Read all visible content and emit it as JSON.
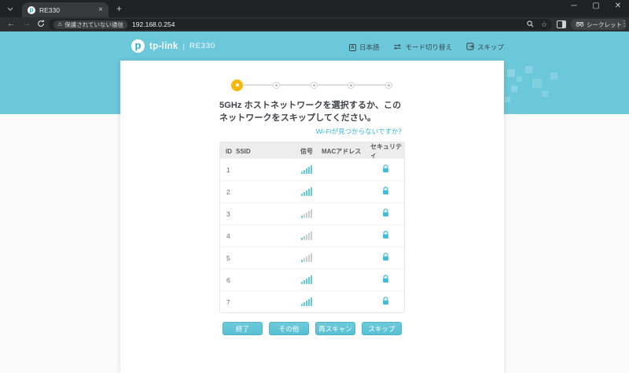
{
  "browser": {
    "tab_title": "RE330",
    "new_tab_label": "+",
    "url": "192.168.0.254",
    "security_chip": "保護されていない通信",
    "incognito_label": "シークレット",
    "window_controls": {
      "minimize": "─",
      "maximize": "▢",
      "close": "✕"
    },
    "back": "←",
    "forward": "→",
    "tab_close": "×",
    "menu": "⋮",
    "bookmark_star": "☆",
    "warning": "⚠"
  },
  "app": {
    "brand": "tp-link",
    "brand_glyph": "p",
    "separator": "|",
    "model": "RE330",
    "nav": [
      {
        "label": "日本語",
        "icon": "language-icon",
        "glyph": "A"
      },
      {
        "label": "モード切り替え",
        "icon": "mode-switch-icon"
      },
      {
        "label": "スキップ",
        "icon": "skip-icon"
      }
    ]
  },
  "wizard": {
    "total_steps": 5,
    "active_step": 1,
    "title": "5GHz ホストネットワークを選択するか、このネットワークをスキップしてください。",
    "help_link": "Wi-Fiが見つからないですか？"
  },
  "network_table": {
    "columns": [
      "ID",
      "SSID",
      "信号",
      "MACアドレス",
      "セキュリティ"
    ],
    "ssid_redacted": true,
    "mac_redacted": true,
    "rows": [
      {
        "id": "1",
        "signal_bars": 5,
        "locked": true
      },
      {
        "id": "2",
        "signal_bars": 5,
        "locked": true
      },
      {
        "id": "3",
        "signal_bars": 1,
        "locked": true
      },
      {
        "id": "4",
        "signal_bars": 1,
        "locked": true
      },
      {
        "id": "5",
        "signal_bars": 1,
        "locked": true
      },
      {
        "id": "6",
        "signal_bars": 5,
        "locked": true
      },
      {
        "id": "7",
        "signal_bars": 5,
        "locked": true
      }
    ]
  },
  "actions": [
    {
      "label": "終了"
    },
    {
      "label": "その他"
    },
    {
      "label": "再スキャン"
    },
    {
      "label": "スキップ"
    }
  ],
  "colors": {
    "band_teal": "#6bc7da",
    "button_teal": "#58c0d3",
    "link_teal": "#35b8d4",
    "signal_teal": "#62c8de",
    "redacted_gray": "#c3c6c9",
    "active_step_gold": "#f5b80c"
  }
}
